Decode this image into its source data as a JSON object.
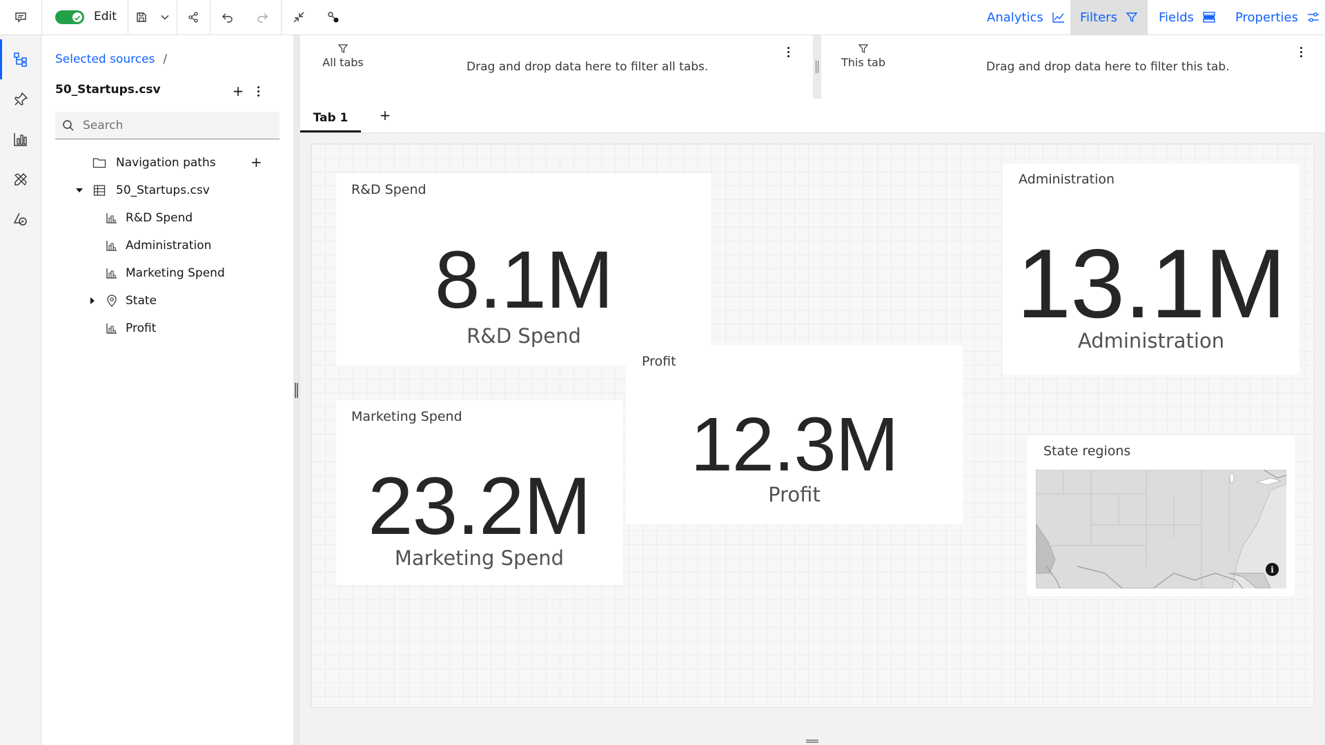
{
  "toolbar": {
    "edit_label": "Edit",
    "edit_enabled": true,
    "right_tabs": [
      {
        "label": "Analytics",
        "icon": "analytics-chart-icon"
      },
      {
        "label": "Filters",
        "icon": "filter-icon",
        "active": true
      },
      {
        "label": "Fields",
        "icon": "fields-icon"
      },
      {
        "label": "Properties",
        "icon": "sliders-icon"
      }
    ]
  },
  "rail": {
    "items": [
      "data-sources-icon",
      "pin-icon",
      "visualizations-icon",
      "assets-icon",
      "shapes-icon"
    ]
  },
  "data_panel": {
    "breadcrumb_link": "Selected sources",
    "breadcrumb_sep": "/",
    "source_name": "50_Startups.csv",
    "search_placeholder": "Search",
    "tree": [
      {
        "label": "Navigation paths",
        "type": "folder"
      },
      {
        "label": "50_Startups.csv",
        "type": "table",
        "expanded": true
      },
      {
        "label": "R&D Spend",
        "type": "measure"
      },
      {
        "label": "Administration",
        "type": "measure"
      },
      {
        "label": "Marketing Spend",
        "type": "measure"
      },
      {
        "label": "State",
        "type": "location",
        "expandable": true
      },
      {
        "label": "Profit",
        "type": "measure"
      }
    ]
  },
  "filters": {
    "all_tabs": {
      "label": "All tabs",
      "hint": "Drag and drop data here to filter all tabs."
    },
    "this_tab": {
      "label": "This tab",
      "hint": "Drag and drop data here to filter this tab."
    }
  },
  "tabs": [
    {
      "label": "Tab 1",
      "active": true
    }
  ],
  "tab_add": "+",
  "widgets": {
    "rd": {
      "title": "R&D Spend",
      "value": "8.1M",
      "caption": "R&D Spend"
    },
    "admin": {
      "title": "Administration",
      "value": "13.1M",
      "caption": "Administration"
    },
    "marketing": {
      "title": "Marketing Spend",
      "value": "23.2M",
      "caption": "Marketing Spend"
    },
    "profit": {
      "title": "Profit",
      "value": "12.3M",
      "caption": "Profit"
    },
    "map": {
      "title": "State regions"
    }
  },
  "colors": {
    "accent": "#0f62fe",
    "toggle_on": "#24a148"
  }
}
